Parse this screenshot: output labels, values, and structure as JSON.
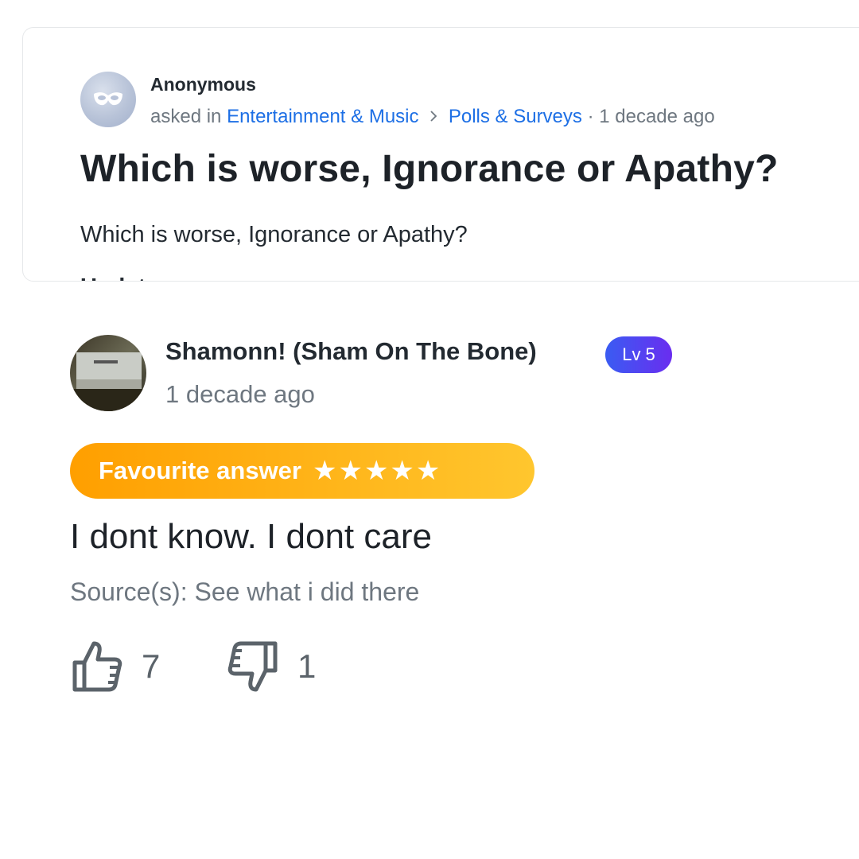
{
  "question": {
    "asker_name": "Anonymous",
    "asked_in": "asked in",
    "category": "Entertainment & Music",
    "subcategory": "Polls & Surveys",
    "separator": "·",
    "time": "1 decade ago",
    "title": "Which is worse, Ignorance or Apathy?",
    "body": "Which is worse, Ignorance or Apathy?",
    "cut_text": "Update"
  },
  "answer": {
    "author": "Shamonn! (Sham On The Bone)",
    "level": "Lv 5",
    "time": "1 decade ago",
    "favourite_label": "Favourite answer",
    "stars": "★★★★★",
    "rating": 5,
    "text": "I dont know. I dont care",
    "source": "Source(s): See what i did there",
    "thumbs_up_count": "7",
    "thumbs_down_count": "1"
  },
  "colors": {
    "link": "#1d6fe5",
    "badge_gradient": [
      "#3a5cf2",
      "#6a2df0"
    ],
    "favourite_gradient": [
      "#ff9f00",
      "#ffc62e"
    ],
    "muted_text": "#6e7780"
  },
  "icons": {
    "asker_avatar": "mask-icon",
    "breadcrumb_separator": "chevron-right-icon",
    "thumbs_up": "thumbs-up-icon",
    "thumbs_down": "thumbs-down-icon"
  }
}
